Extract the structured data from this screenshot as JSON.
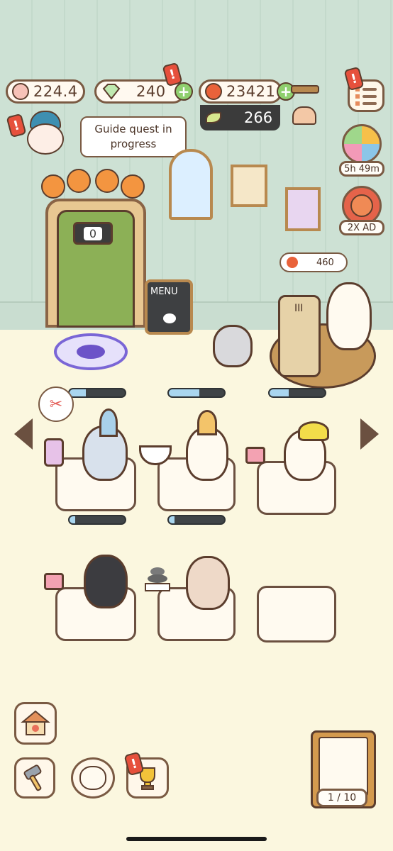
{
  "hud": {
    "paw_currency": "224.4",
    "gem_currency": "240",
    "apple_currency": "23421",
    "leaf_currency": "266"
  },
  "alerts": {
    "mark": "!"
  },
  "quest": {
    "text": "Guide quest in progress"
  },
  "timers": {
    "wheel_timer": "5h 49m",
    "ad_label": "2X AD"
  },
  "door": {
    "counter": "0"
  },
  "menu_board": {
    "label": "MENU"
  },
  "order": {
    "value": "460",
    "cup_label": "III"
  },
  "pagination": {
    "page": "1 / 10"
  },
  "colors": {
    "wall": "#cde1d4",
    "floor": "#fbf7df",
    "outline": "#7a5a43",
    "alert_red": "#e6503c",
    "plus_green": "#8fcf6e",
    "progress_fill": "#a9d6ef"
  },
  "progress": {
    "station1": 0.3,
    "station2": 0.55,
    "station3": 0.35,
    "bed1": 0.1,
    "bed2": 0.1
  }
}
